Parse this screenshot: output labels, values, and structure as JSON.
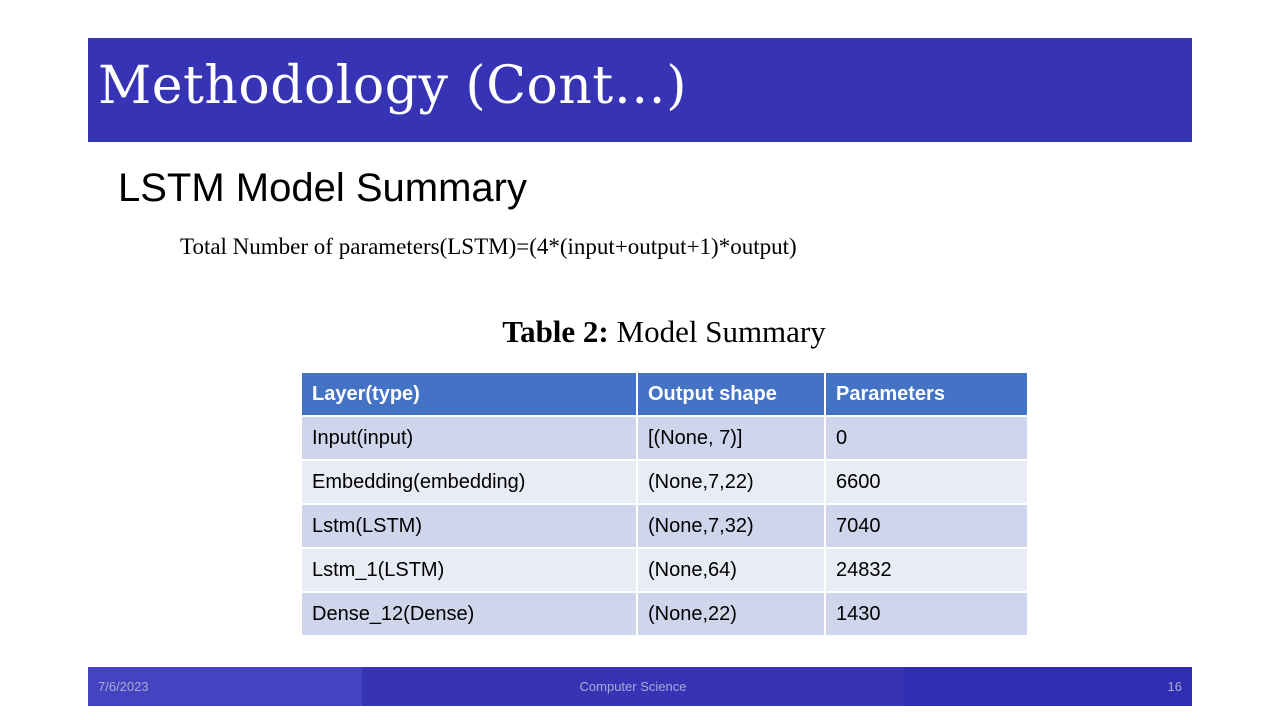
{
  "slide": {
    "title": "Methodology (Cont…)",
    "subtitle": "LSTM Model Summary",
    "formula": "Total Number of  parameters(LSTM)=(4*(input+output+1)*output)",
    "caption_label": "Table 2:",
    "caption_text": " Model Summary"
  },
  "table": {
    "headers": [
      "Layer(type)",
      "Output shape",
      "Parameters"
    ],
    "rows": [
      [
        "Input(input)",
        "[(None, 7)]",
        "0"
      ],
      [
        "Embedding(embedding)",
        "(None,7,22)",
        "6600"
      ],
      [
        "Lstm(LSTM)",
        "(None,7,32)",
        "7040"
      ],
      [
        "Lstm_1(LSTM)",
        "(None,64)",
        "24832"
      ],
      [
        "Dense_12(Dense)",
        "(None,22)",
        "1430"
      ]
    ]
  },
  "footer": {
    "date": "7/6/2023",
    "center": "Computer Science",
    "page": "16"
  },
  "colors": {
    "title_bar": "#3634b5",
    "table_header": "#4472c4",
    "row_odd": "#cfd5ea",
    "row_even": "#e9ebf5"
  }
}
